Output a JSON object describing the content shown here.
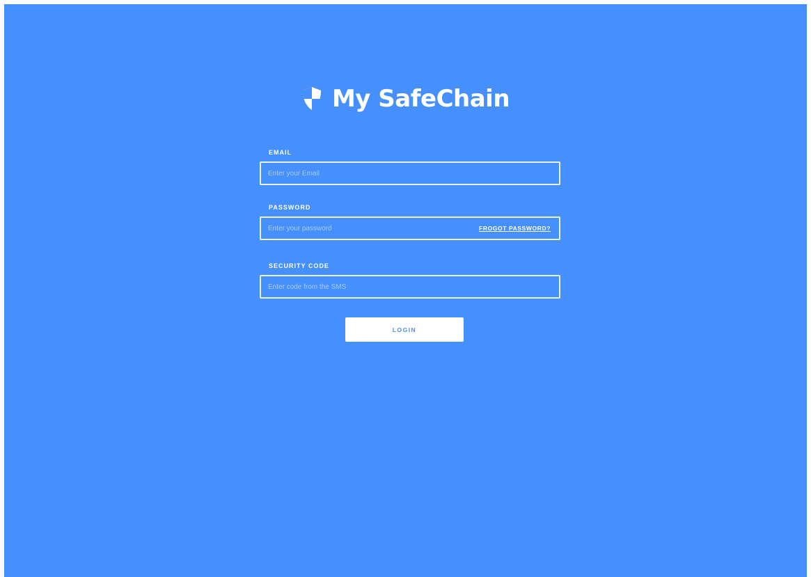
{
  "brand": {
    "name": "My SafeChain",
    "icon": "shield-icon"
  },
  "form": {
    "email": {
      "label": "EMAIL",
      "placeholder": "Enter your Email",
      "value": ""
    },
    "password": {
      "label": "PASSWORD",
      "placeholder": "Enter your password",
      "value": "",
      "forgot_label": "FROGOT PASSWORD?"
    },
    "security_code": {
      "label": "SECURITY CODE",
      "placeholder": "Enter code from the SMS",
      "value": ""
    },
    "login_label": "LOGIN"
  },
  "colors": {
    "background": "#4690fe",
    "text": "#ffffff",
    "placeholder": "#a9ccff",
    "button_background": "#ffffff",
    "button_text": "#4690fe"
  }
}
